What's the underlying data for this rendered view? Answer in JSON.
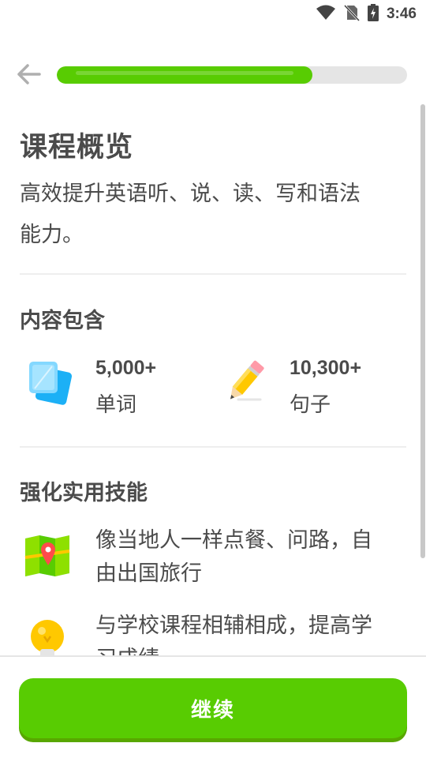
{
  "status_bar": {
    "time": "3:46",
    "icons": [
      "wifi-icon",
      "no-sim-icon",
      "battery-charging-icon"
    ]
  },
  "header": {
    "back_icon": "arrow-left-icon",
    "progress_fraction": 0.73,
    "colors": {
      "fill": "#58cc02",
      "track": "#e5e5e5"
    }
  },
  "overview": {
    "title": "课程概览",
    "subtitle_line1": "高效提升英语听、说、读、写和语法",
    "subtitle_line2": "能力。"
  },
  "contents": {
    "heading": "内容包含",
    "items": [
      {
        "icon": "flashcards-icon",
        "value": "5,000+",
        "label": "单词"
      },
      {
        "icon": "pencil-icon",
        "value": "10,300+",
        "label": "句子"
      }
    ]
  },
  "skills": {
    "heading": "强化实用技能",
    "items": [
      {
        "icon": "map-pin-icon",
        "line1": "像当地人一样点餐、问路，自",
        "line2": "由出国旅行"
      },
      {
        "icon": "lightbulb-icon",
        "line1": "与学校课程相辅相成，提高学",
        "line2": "习成绩"
      }
    ]
  },
  "footer": {
    "continue_label": "继续",
    "colors": {
      "button": "#58cc02",
      "button_shadow": "#58a700"
    }
  }
}
